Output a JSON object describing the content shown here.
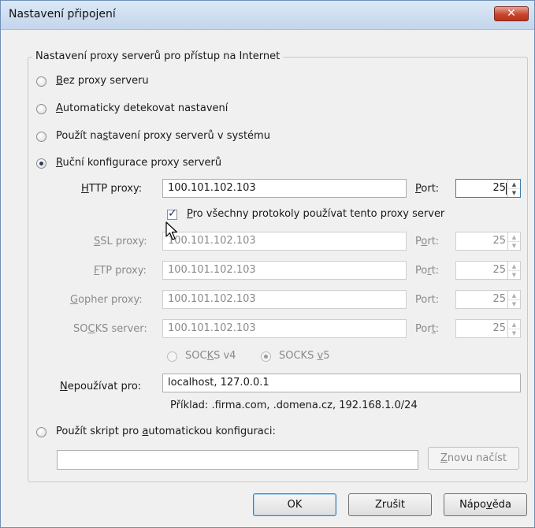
{
  "window": {
    "title": "Nastavení připojení"
  },
  "group": {
    "label": "Nastavení proxy serverů pro přístup na Internet"
  },
  "radios": {
    "no_proxy": {
      "pre": "",
      "key": "B",
      "post": "ez proxy serveru"
    },
    "auto_detect": {
      "pre": "",
      "key": "A",
      "post": "utomaticky detekovat nastavení"
    },
    "system": {
      "pre": "Použít na",
      "key": "s",
      "post": "tavení proxy serverů v systému"
    },
    "manual": {
      "pre": "",
      "key": "R",
      "post": "uční konfigurace proxy serverů"
    },
    "pac": {
      "pre": "Použít skript pro ",
      "key": "a",
      "post": "utomatickou konfiguraci:"
    }
  },
  "http": {
    "label_key": "H",
    "label_rest": "TTP proxy:",
    "value": "100.101.102.103",
    "port_key": "P",
    "port_rest": "ort:",
    "port": "25"
  },
  "same_proxy": {
    "key": "P",
    "rest": "ro všechny protokoly používat tento proxy server"
  },
  "ssl": {
    "label_key": "S",
    "label_rest": "SL proxy:",
    "value": "100.101.102.103",
    "port_pre": "P",
    "port_key": "o",
    "port_rest": "rt:",
    "port": "25"
  },
  "ftp": {
    "label_key": "F",
    "label_rest": "TP proxy:",
    "value": "100.101.102.103",
    "port_pre": "Po",
    "port_key": "r",
    "port_rest": "t:",
    "port": "25"
  },
  "gopher": {
    "label_key": "G",
    "label_rest": "opher proxy:",
    "value": "100.101.102.103",
    "port_label": "Port:",
    "port": "25"
  },
  "socks": {
    "label_pre": "SO",
    "label_key": "C",
    "label_rest": "KS server:",
    "value": "100.101.102.103",
    "port_pre": "Por",
    "port_key": "t",
    "port_rest": ":",
    "port": "25"
  },
  "socks_version": {
    "v4_pre": "SOC",
    "v4_key": "K",
    "v4_rest": "S v4",
    "v5_pre": "SOCKS ",
    "v5_key": "v",
    "v5_rest": "5"
  },
  "no_proxy_for": {
    "label_key": "N",
    "label_rest": "epoužívat pro:",
    "value": "localhost, 127.0.0.1",
    "example": "Příklad: .firma.com, .domena.cz, 192.168.1.0/24"
  },
  "pac_url": {
    "value": ""
  },
  "reload_button": {
    "key": "Z",
    "rest": "novu načíst"
  },
  "buttons": {
    "ok": "OK",
    "cancel": "Zrušit",
    "help_pre": "Nápo",
    "help_key": "v",
    "help_rest": "ěda"
  },
  "icons": {
    "close": "close-icon",
    "cursor": "mouse-pointer-icon",
    "spin_up": "spin-up-icon",
    "spin_down": "spin-down-icon"
  }
}
